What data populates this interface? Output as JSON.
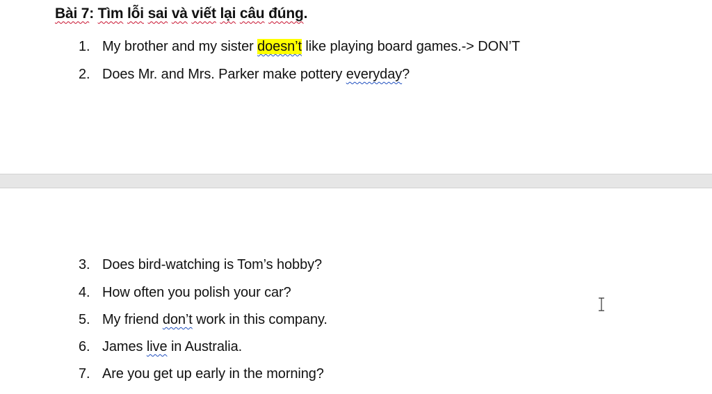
{
  "heading": {
    "part1": "Bài 7",
    "part2": ": ",
    "part3": "Tìm",
    "part4": " ",
    "part5": "lỗi",
    "part6": " ",
    "part7": "sai",
    "part8": " ",
    "part9": "và",
    "part10": " ",
    "part11": "viết",
    "part12": " ",
    "part13": "lại",
    "part14": " ",
    "part15": "câu",
    "part16": " ",
    "part17": "đúng",
    "part18": "."
  },
  "items": [
    {
      "num": "1.",
      "pre": "My brother and my sister ",
      "highlight": "doesn’t",
      "post": " like playing board games.-> DON’T"
    },
    {
      "num": "2.",
      "pre": "Does Mr. and Mrs. Parker make pottery ",
      "flag": "everyday",
      "post": "?"
    },
    {
      "num": "3.",
      "text": "Does bird-watching is Tom’s hobby?"
    },
    {
      "num": "4.",
      "text": "How often you polish your car?"
    },
    {
      "num": "5.",
      "pre": "My friend ",
      "flag": "don’t",
      "post": " work in this company."
    },
    {
      "num": "6.",
      "pre": "James ",
      "flag": "live",
      "post": " in Australia."
    },
    {
      "num": "7.",
      "text": "Are you get up early in the morning?"
    }
  ],
  "colors": {
    "highlight": "#ffff00",
    "spell_error": "#c8102e",
    "grammar_flag": "#1f4fbf",
    "page_gap": "#e6e6e6"
  },
  "cursor": {
    "icon": "text-cursor-icon"
  }
}
